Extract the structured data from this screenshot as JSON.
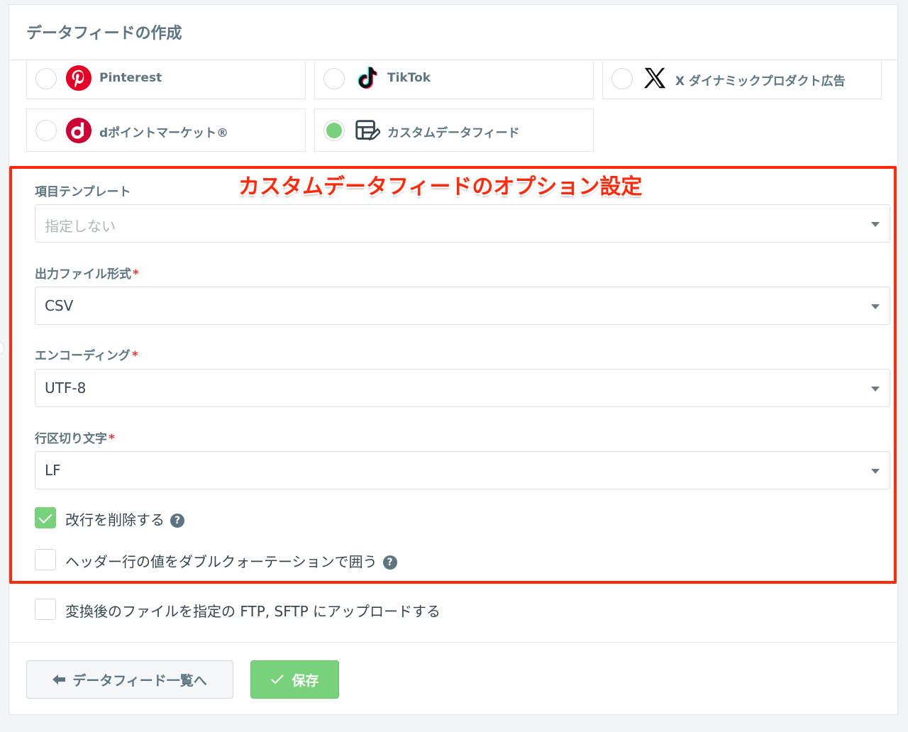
{
  "page": {
    "title": "データフィードの作成"
  },
  "channels": [
    {
      "label": "Pinterest",
      "icon": "pinterest-icon",
      "selected": false
    },
    {
      "label": "TikTok",
      "icon": "tiktok-icon",
      "selected": false
    },
    {
      "label": "X ダイナミックプロダクト広告",
      "icon": "x-icon",
      "selected": false
    },
    {
      "label": "dポイントマーケット®",
      "icon": "dpoint-icon",
      "selected": false
    },
    {
      "label": "カスタムデータフィード",
      "icon": "custom-feed-icon",
      "selected": true
    }
  ],
  "annotation": {
    "text": "カスタムデータフィードのオプション設定",
    "color": "#ff2a0c"
  },
  "fields": {
    "template": {
      "label": "項目テンプレート",
      "placeholder": "指定しない"
    },
    "format": {
      "label": "出力ファイル形式",
      "required": "*",
      "value": "CSV"
    },
    "encoding": {
      "label": "エンコーディング",
      "required": "*",
      "value": "UTF-8"
    },
    "linebreak": {
      "label": "行区切り文字",
      "required": "*",
      "value": "LF"
    }
  },
  "checkboxes": {
    "remove_newline": {
      "label": "改行を削除する",
      "checked": true,
      "help": "?"
    },
    "quote_header": {
      "label": "ヘッダー行の値をダブルクォーテーションで囲う",
      "checked": false,
      "help": "?"
    },
    "ftp_upload": {
      "label": "変換後のファイルを指定の FTP, SFTP にアップロードする",
      "checked": false
    }
  },
  "buttons": {
    "back": {
      "label": "データフィード一覧へ"
    },
    "save": {
      "label": "保存"
    }
  },
  "colors": {
    "accent": "#78d17b",
    "label": "#5d7580",
    "required": "#e53935"
  }
}
